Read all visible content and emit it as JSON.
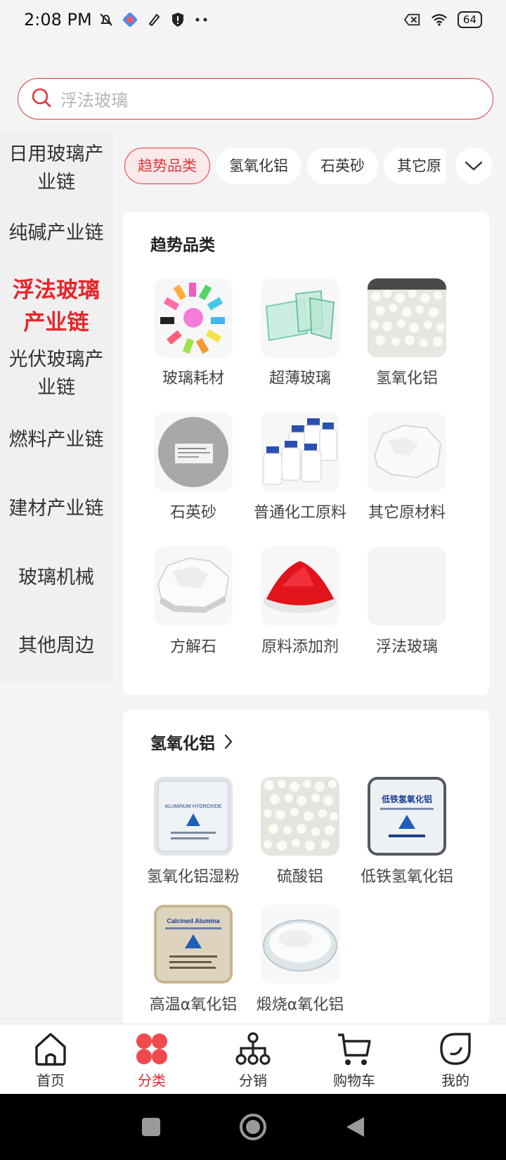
{
  "status_bar": {
    "time": "2:08 PM",
    "battery": "64"
  },
  "search": {
    "placeholder": "浮法玻璃"
  },
  "sidebar": {
    "items": [
      {
        "label": "日用玻璃产业链"
      },
      {
        "label": "纯碱产业链"
      },
      {
        "label": "浮法玻璃产业链",
        "active": true
      },
      {
        "label": "光伏玻璃产业链"
      },
      {
        "label": "燃料产业链"
      },
      {
        "label": "建材产业链"
      },
      {
        "label": "玻璃机械"
      },
      {
        "label": "其他周边"
      }
    ]
  },
  "chips": [
    {
      "label": "趋势品类",
      "active": true
    },
    {
      "label": "氢氧化铝"
    },
    {
      "label": "石英砂"
    },
    {
      "label": "其它原"
    }
  ],
  "trend_section": {
    "title": "趋势品类",
    "items": [
      {
        "label": "玻璃耗材"
      },
      {
        "label": "超薄玻璃"
      },
      {
        "label": "氢氧化铝"
      },
      {
        "label": "石英砂"
      },
      {
        "label": "普通化工原料"
      },
      {
        "label": "其它原材料"
      },
      {
        "label": "方解石"
      },
      {
        "label": "原料添加剂"
      },
      {
        "label": "浮法玻璃"
      }
    ]
  },
  "aluminum_section": {
    "title": "氢氧化铝",
    "items": [
      {
        "label": "氢氧化铝湿粉",
        "bag_text": "ALUMINUM HYDROXIDE"
      },
      {
        "label": "硫酸铝"
      },
      {
        "label": "低铁氢氧化铝",
        "bag_text": "低铁氢氧化铝"
      },
      {
        "label": "高温α氧化铝",
        "bag_text": "Calcined Alumina"
      },
      {
        "label": "煅烧α氧化铝"
      }
    ]
  },
  "tabbar": {
    "tabs": [
      {
        "label": "首页",
        "icon": "home-icon"
      },
      {
        "label": "分类",
        "icon": "category-icon",
        "active": true
      },
      {
        "label": "分销",
        "icon": "distribution-icon"
      },
      {
        "label": "购物车",
        "icon": "cart-icon"
      },
      {
        "label": "我的",
        "icon": "profile-icon"
      }
    ]
  },
  "colors": {
    "accent": "#e8252b",
    "background": "#f4f4f4"
  }
}
